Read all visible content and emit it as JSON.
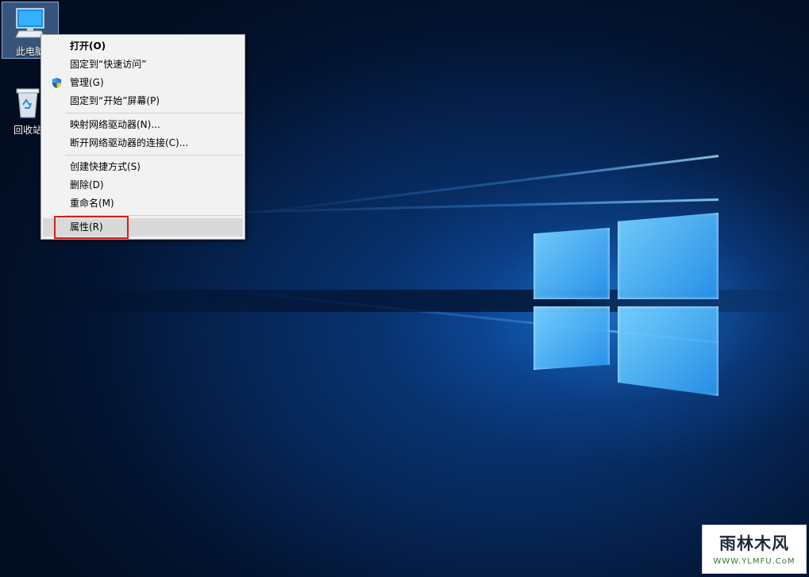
{
  "desktop": {
    "icons": [
      {
        "label": "此电脑",
        "icon": "this-pc-icon",
        "selected": true
      },
      {
        "label": "回收站",
        "icon": "recycle-bin-icon",
        "selected": false
      }
    ]
  },
  "context_menu": {
    "items": [
      {
        "label": "打开(O)",
        "bold": true
      },
      {
        "label": "固定到“快速访问”"
      },
      {
        "label": "管理(G)",
        "icon": "uac-shield-icon"
      },
      {
        "label": "固定到“开始”屏幕(P)"
      },
      {
        "label": "映射网络驱动器(N)..."
      },
      {
        "label": "断开网络驱动器的连接(C)..."
      },
      {
        "label": "创建快捷方式(S)"
      },
      {
        "label": "删除(D)"
      },
      {
        "label": "重命名(M)"
      },
      {
        "label": "属性(R)",
        "highlighted": true
      }
    ],
    "annotation_color": "#d21f1f"
  },
  "watermark": {
    "title": "雨林木风",
    "url": "WWW.YLMFU.CoM"
  },
  "colors": {
    "wallpaper_dark": "#031533",
    "wallpaper_glow": "#2896ff",
    "menu_bg": "#f2f2f2"
  }
}
